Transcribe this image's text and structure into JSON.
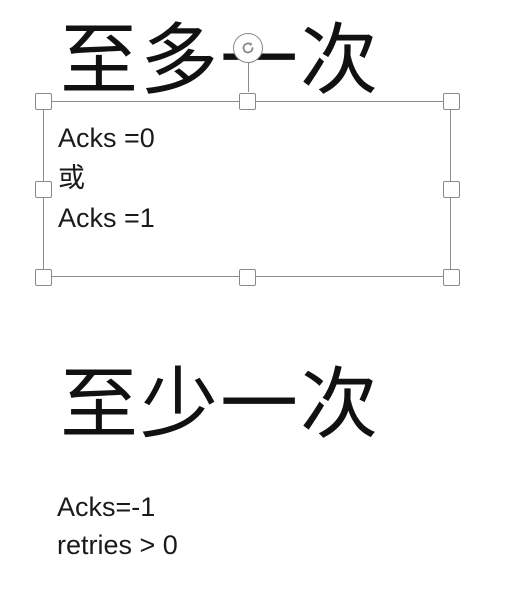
{
  "slide": {
    "heading_top": "至多一次",
    "textbox_lines": [
      "Acks =0",
      "或",
      "Acks =1"
    ],
    "heading_bottom": "至少一次",
    "body_lines": [
      "Acks=-1",
      "retries > 0"
    ]
  },
  "icons": {
    "rotate": "rotate-icon"
  },
  "colors": {
    "selection_border": "#8c8c8c",
    "text": "#1a1a1a"
  }
}
